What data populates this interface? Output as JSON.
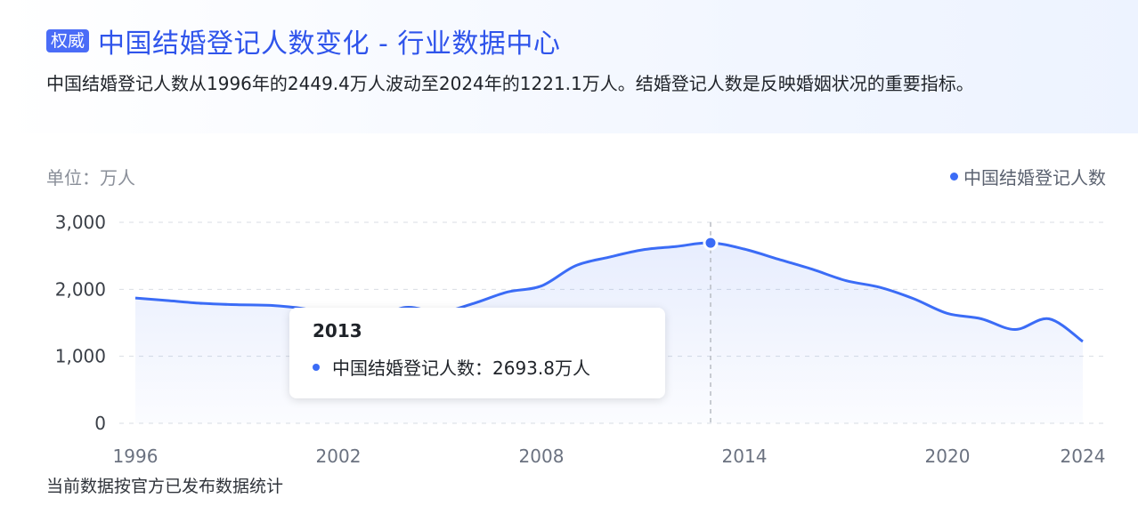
{
  "header": {
    "badge": "权威",
    "title": "中国结婚登记人数变化 - 行业数据中心",
    "description": "中国结婚登记人数从1996年的2449.4万人波动至2024年的1221.1万人。结婚登记人数是反映婚姻状况的重要指标。"
  },
  "unit_label": "单位：万人",
  "footnote": "当前数据按官方已发布数据统计",
  "tooltip": {
    "year": "2013",
    "series": "中国结婚登记人数",
    "sep": "：",
    "value_text": "2693.8万人"
  },
  "colors": {
    "accent": "#3b6cf6",
    "title": "#2f54eb",
    "badge": "#4a6cf7"
  },
  "chart_data": {
    "type": "line",
    "series": [
      {
        "name": "中国结婚登记人数",
        "x": [
          1996,
          1997,
          1998,
          1999,
          2000,
          2001,
          2002,
          2003,
          2004,
          2005,
          2006,
          2007,
          2008,
          2009,
          2010,
          2011,
          2012,
          2013,
          2014,
          2015,
          2016,
          2017,
          2018,
          2019,
          2020,
          2021,
          2022,
          2023,
          2024
        ],
        "values": [
          1870,
          1830,
          1790,
          1770,
          1760,
          1710,
          1610,
          1570,
          1730,
          1660,
          1790,
          1960,
          2050,
          2350,
          2480,
          2590,
          2640,
          2693.8,
          2600,
          2450,
          2300,
          2130,
          2030,
          1860,
          1640,
          1560,
          1400,
          1560,
          1221.1
        ]
      }
    ],
    "x_ticks": [
      "1996",
      "2002",
      "2008",
      "2014",
      "2020",
      "2024"
    ],
    "y_ticks": [
      "0",
      "1,000",
      "2,000",
      "3,000"
    ],
    "ylim": [
      0,
      3000
    ],
    "xlim": [
      1996,
      2024
    ],
    "highlight_x": 2013,
    "legend": "top-right",
    "grid": true
  }
}
